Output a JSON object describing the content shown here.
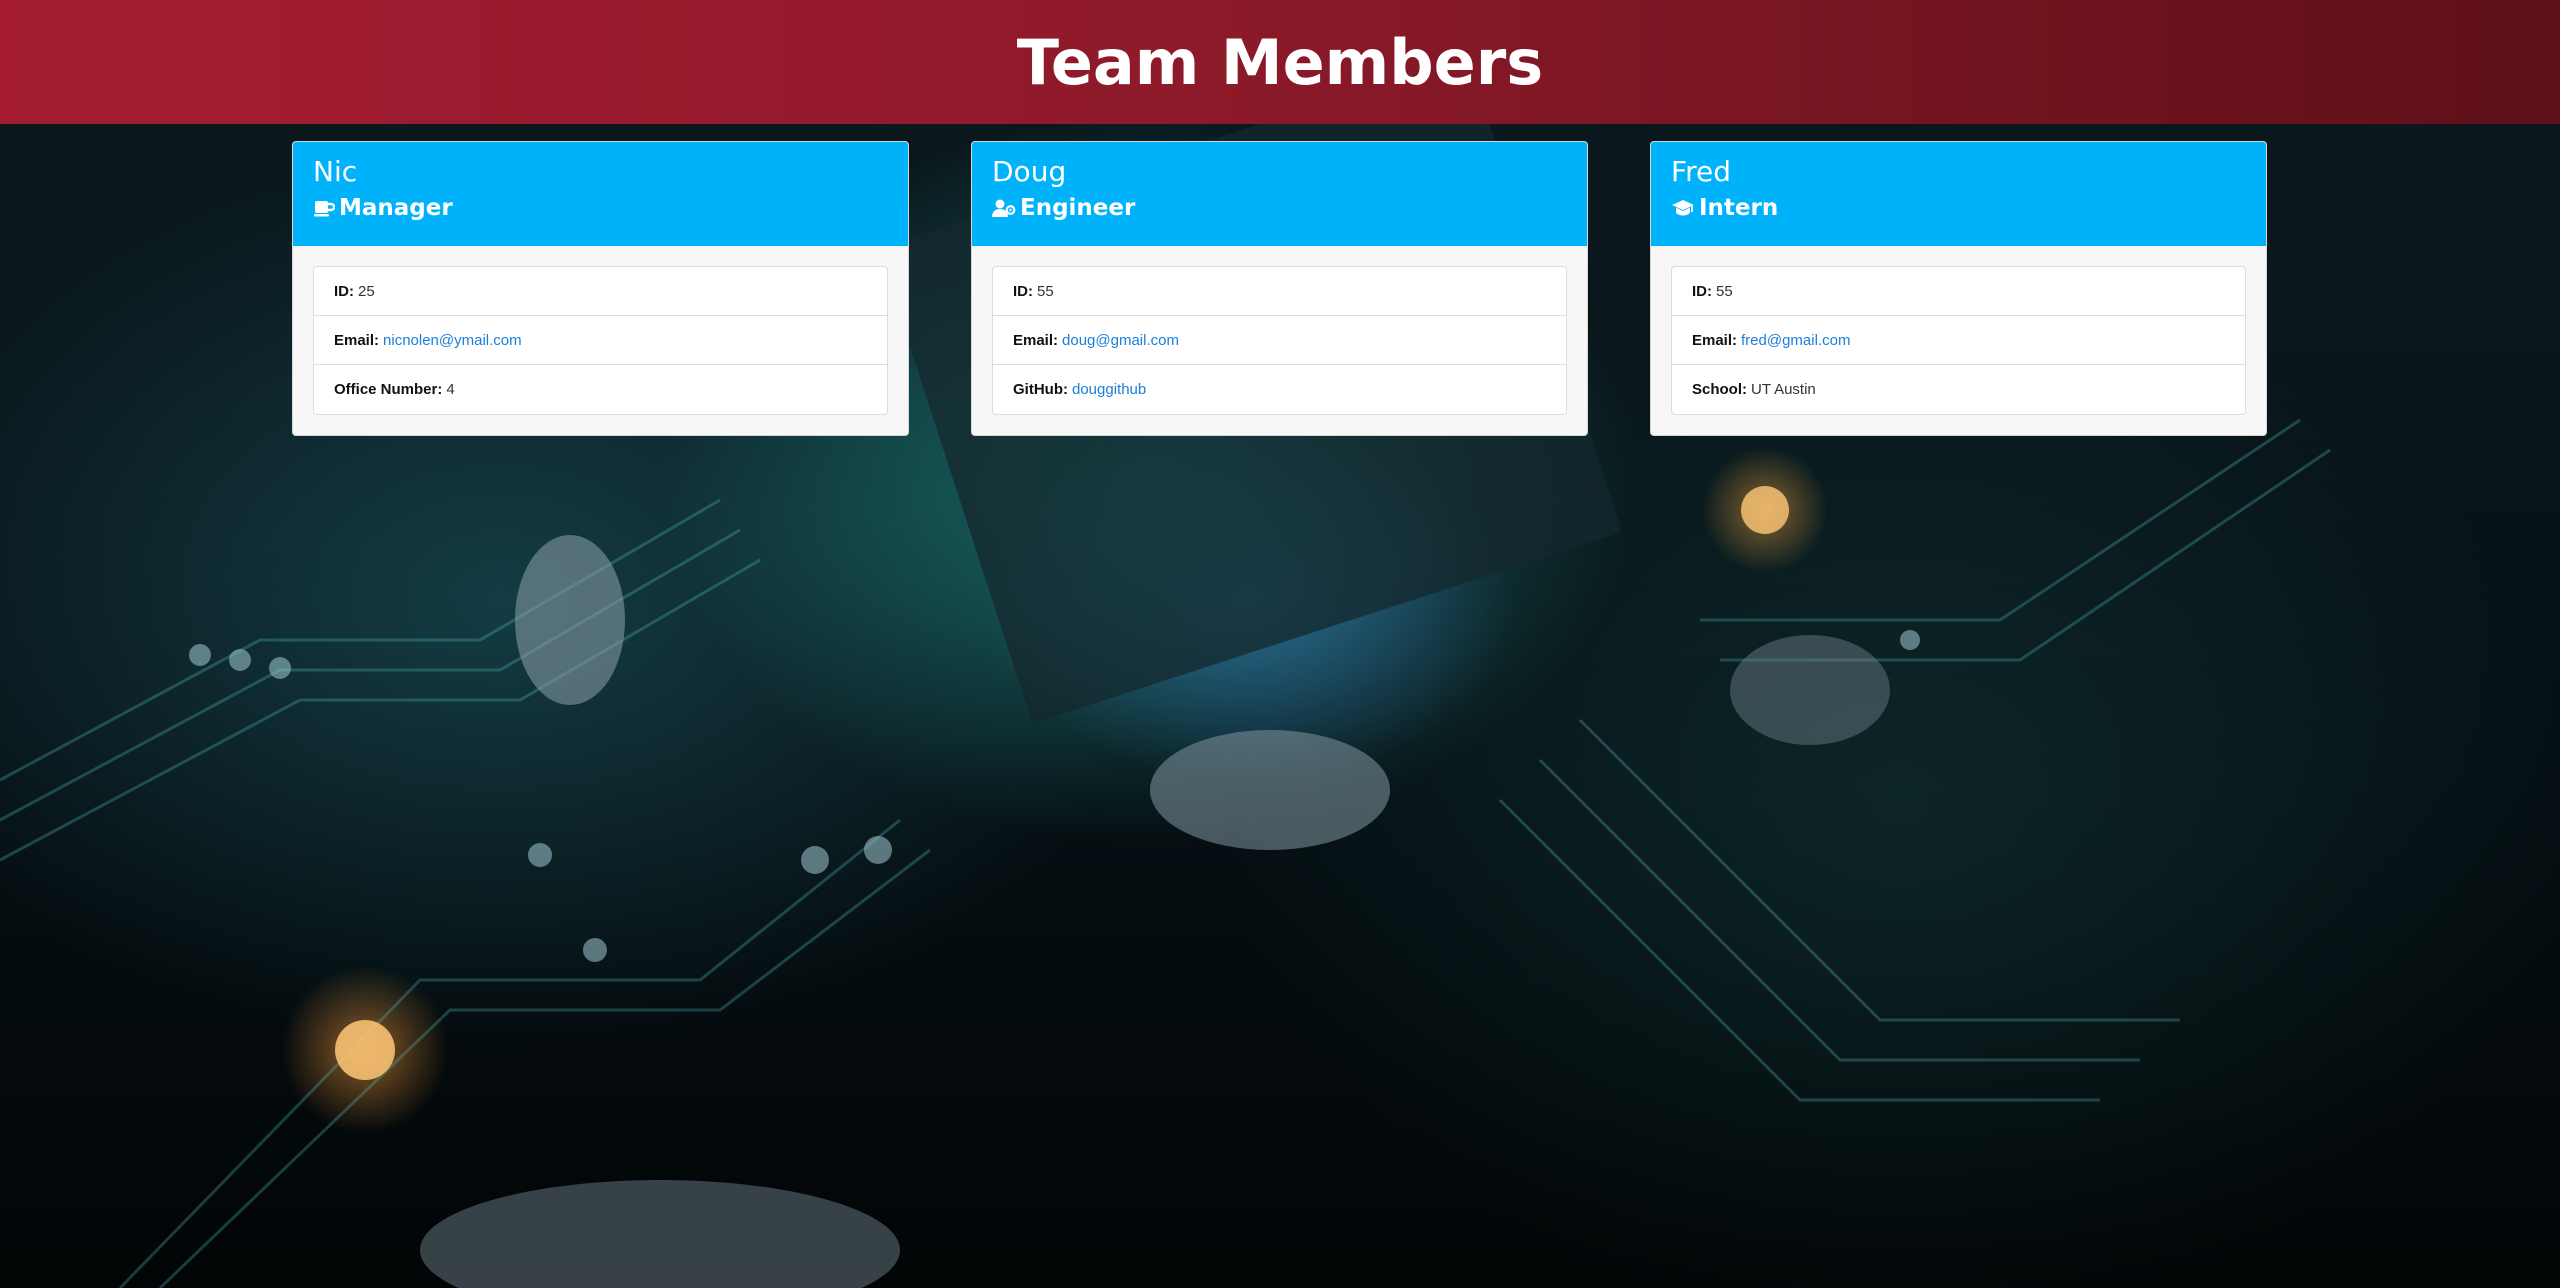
{
  "header": {
    "title": "Team Members"
  },
  "members": [
    {
      "name": "Nic",
      "role": "Manager",
      "role_icon": "mug-icon",
      "fields": [
        {
          "label": "ID:",
          "value": "25",
          "link": false
        },
        {
          "label": "Email:",
          "value": "nicnolen@ymail.com",
          "link": true
        },
        {
          "label": "Office Number:",
          "value": "4",
          "link": false
        }
      ]
    },
    {
      "name": "Doug",
      "role": "Engineer",
      "role_icon": "user-gear-icon",
      "fields": [
        {
          "label": "ID:",
          "value": "55",
          "link": false
        },
        {
          "label": "Email:",
          "value": "doug@gmail.com",
          "link": true
        },
        {
          "label": "GitHub:",
          "value": "douggithub",
          "link": true
        }
      ]
    },
    {
      "name": "Fred",
      "role": "Intern",
      "role_icon": "graduation-cap-icon",
      "fields": [
        {
          "label": "ID:",
          "value": "55",
          "link": false
        },
        {
          "label": "Email:",
          "value": "fred@gmail.com",
          "link": true
        },
        {
          "label": "School:",
          "value": "UT Austin",
          "link": false
        }
      ]
    }
  ],
  "colors": {
    "header_start": "#a51c30",
    "header_end": "#5e1018",
    "card_header": "#00b2fa",
    "link": "#1a7fdb"
  }
}
